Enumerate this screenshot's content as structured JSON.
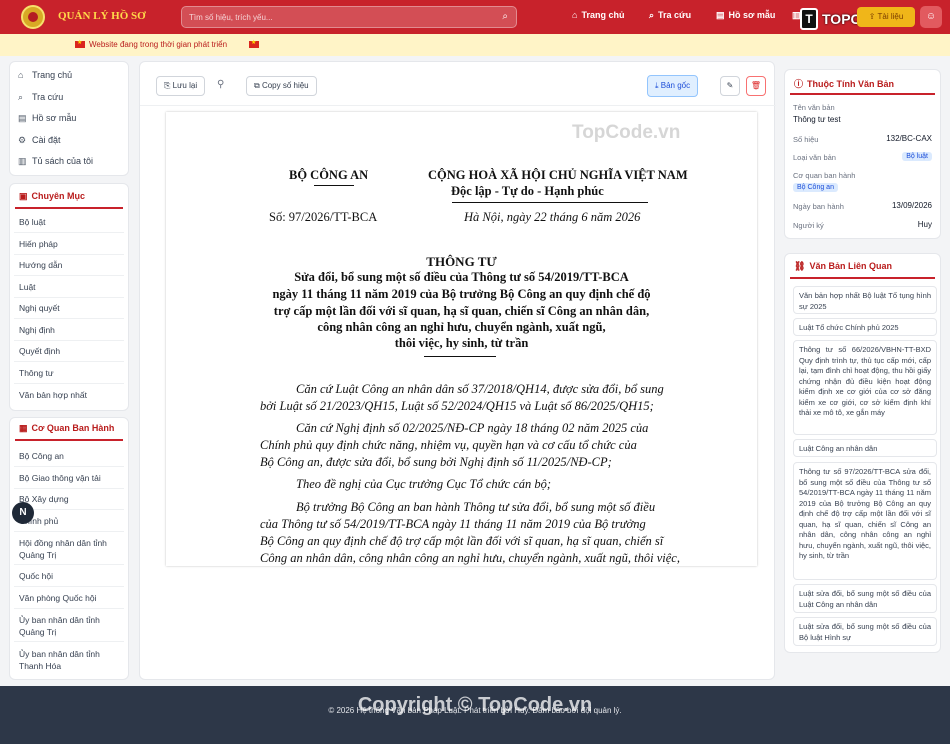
{
  "header": {
    "brand": "QUẢN LÝ HỒ SƠ",
    "search_placeholder": "Tìm số hiệu, trích yếu...",
    "nav": [
      "Trang chủ",
      "Tra cứu",
      "Hồ sơ mẫu",
      "Tài liệu"
    ],
    "watermark_logo": "TOPCODE.VN"
  },
  "banner": {
    "text": "Website đang trong thời gian phát triển"
  },
  "sidebar": {
    "main_nav": [
      "Trang chủ",
      "Tra cứu",
      "Hồ sơ mẫu",
      "Cài đặt",
      "Tủ sách của tôi"
    ],
    "categories_title": "Chuyên Mục",
    "categories": [
      "Bộ luật",
      "Hiến pháp",
      "Hướng dẫn",
      "Luật",
      "Nghị quyết",
      "Nghị định",
      "Quyết định",
      "Thông tư",
      "Văn bản hợp nhất"
    ],
    "agencies_title": "Cơ Quan Ban Hành",
    "agencies": [
      "Bộ Công an",
      "Bộ Giao thông vận tải",
      "Bộ Xây dựng",
      "Chính phủ",
      "Hội đồng nhân dân tỉnh Quảng Trị",
      "Quốc hội",
      "Văn phòng Quốc hội",
      "Ủy ban nhân dân tỉnh Quảng Trị",
      "Ủy ban nhân dân tỉnh Thanh Hóa"
    ]
  },
  "toolbar": {
    "save": "Lưu lại",
    "copy": "Copy số hiệu",
    "original": "Bản gốc"
  },
  "document": {
    "agency": "BỘ CÔNG AN",
    "motto1": "CỘNG HOÀ XÃ HỘI CHỦ NGHĨA VIỆT NAM",
    "motto2": "Độc lập - Tự do - Hạnh phúc",
    "number": "Số: 97/2026/TT-BCA",
    "place_date": "Hà Nội, ngày 22 tháng 6 năm 2026",
    "type": "THÔNG TƯ",
    "title_lines": [
      "Sửa đổi, bổ sung một số điều của Thông tư số 54/2019/TT-BCA",
      "ngày 11 tháng 11 năm 2019 của Bộ trưởng Bộ Công an quy định chế độ",
      "trợ cấp một lần đối với sĩ quan, hạ sĩ quan, chiến sĩ Công an nhân dân,",
      "công nhân công an nghỉ hưu, chuyển ngành, xuất ngũ,",
      "thôi việc, hy sinh, từ trần"
    ],
    "body_lines": [
      "Căn cứ Luật Công an nhân dân số 37/2018/QH14, được sửa đổi, bổ sung",
      "bởi Luật số 21/2023/QH15, Luật số 52/2024/QH15 và Luật số 86/2025/QH15;",
      "Căn cứ Nghị định số 02/2025/NĐ-CP ngày 18 tháng 02 năm 2025 của",
      "Chính phủ quy định chức năng, nhiệm vụ, quyền hạn và cơ cấu tổ chức của",
      "Bộ Công an, được sửa đổi, bổ sung bởi Nghị định số 11/2025/NĐ-CP;",
      "Theo đề nghị của Cục trưởng Cục Tổ chức cán bộ;",
      "Bộ trưởng Bộ Công an ban hành Thông tư sửa đổi, bổ sung một số điều",
      "của Thông tư số 54/2019/TT-BCA ngày 11 tháng 11 năm 2019 của Bộ trưởng",
      "Bộ Công an quy định chế độ trợ cấp một lần đối với sĩ quan, hạ sĩ quan, chiến sĩ",
      "Công an nhân dân, công nhân công an nghỉ hưu, chuyển ngành, xuất ngũ, thôi việc,"
    ],
    "watermark": "TopCode.vn"
  },
  "properties": {
    "title": "Thuộc Tính Văn Bản",
    "name_label": "Tên văn bản",
    "name": "Thông tư test",
    "number_label": "Số hiệu",
    "number": "132/BC-CAX",
    "type_label": "Loại văn bản",
    "type": "Bộ luật",
    "agency_label": "Cơ quan ban hành",
    "agency": "Bộ Công an",
    "date_label": "Ngày ban hành",
    "date": "13/09/2026",
    "signer_label": "Người ký",
    "signer": "Huy"
  },
  "related": {
    "title": "Văn Bản Liên Quan",
    "items": [
      "Văn bản hợp nhất Bộ luật Tố tụng hình sự 2025",
      "Luật Tổ chức Chính phủ 2025",
      "Thông tư số 66/2026/VBHN-TT-BXD Quy định trình tự, thủ tục cấp mới, cấp lại, tạm đình chỉ hoạt động, thu hồi giấy chứng nhận đủ điều kiện hoạt động kiểm định xe cơ giới của cơ sở đăng kiểm xe cơ giới, cơ sở kiểm định khí thải xe mô tô, xe gắn máy",
      "Luật Công an nhân dân",
      "Thông tư số 97/2026/TT-BCA sửa đổi, bổ sung một số điều của Thông tư số 54/2019/TT-BCA ngày 11 tháng 11 năm 2019 của Bộ trưởng Bộ Công an quy định chế độ trợ cấp một lần đối với sĩ quan, hạ sĩ quan, chiến sĩ Công an nhân dân, công nhân công an nghỉ hưu, chuyển ngành, xuất ngũ, thôi việc, hy sinh, từ trần",
      "Luật sửa đổi, bổ sung một số điều của Luật Công an nhân dân",
      "Luật sửa đổi, bổ sung một số điều của Bộ luật Hình sự"
    ]
  },
  "footer": {
    "text": "© 2026 Hệ thống Văn bản Pháp Luật. Phát triển bởi Huy. Đảm bảo bởi đội quản lý.",
    "watermark": "Copyright © TopCode.vn"
  },
  "floating_avatar": "N",
  "colors": {
    "primary": "#c8222b",
    "accent": "#f0b619",
    "banner": "#fff4c7"
  }
}
